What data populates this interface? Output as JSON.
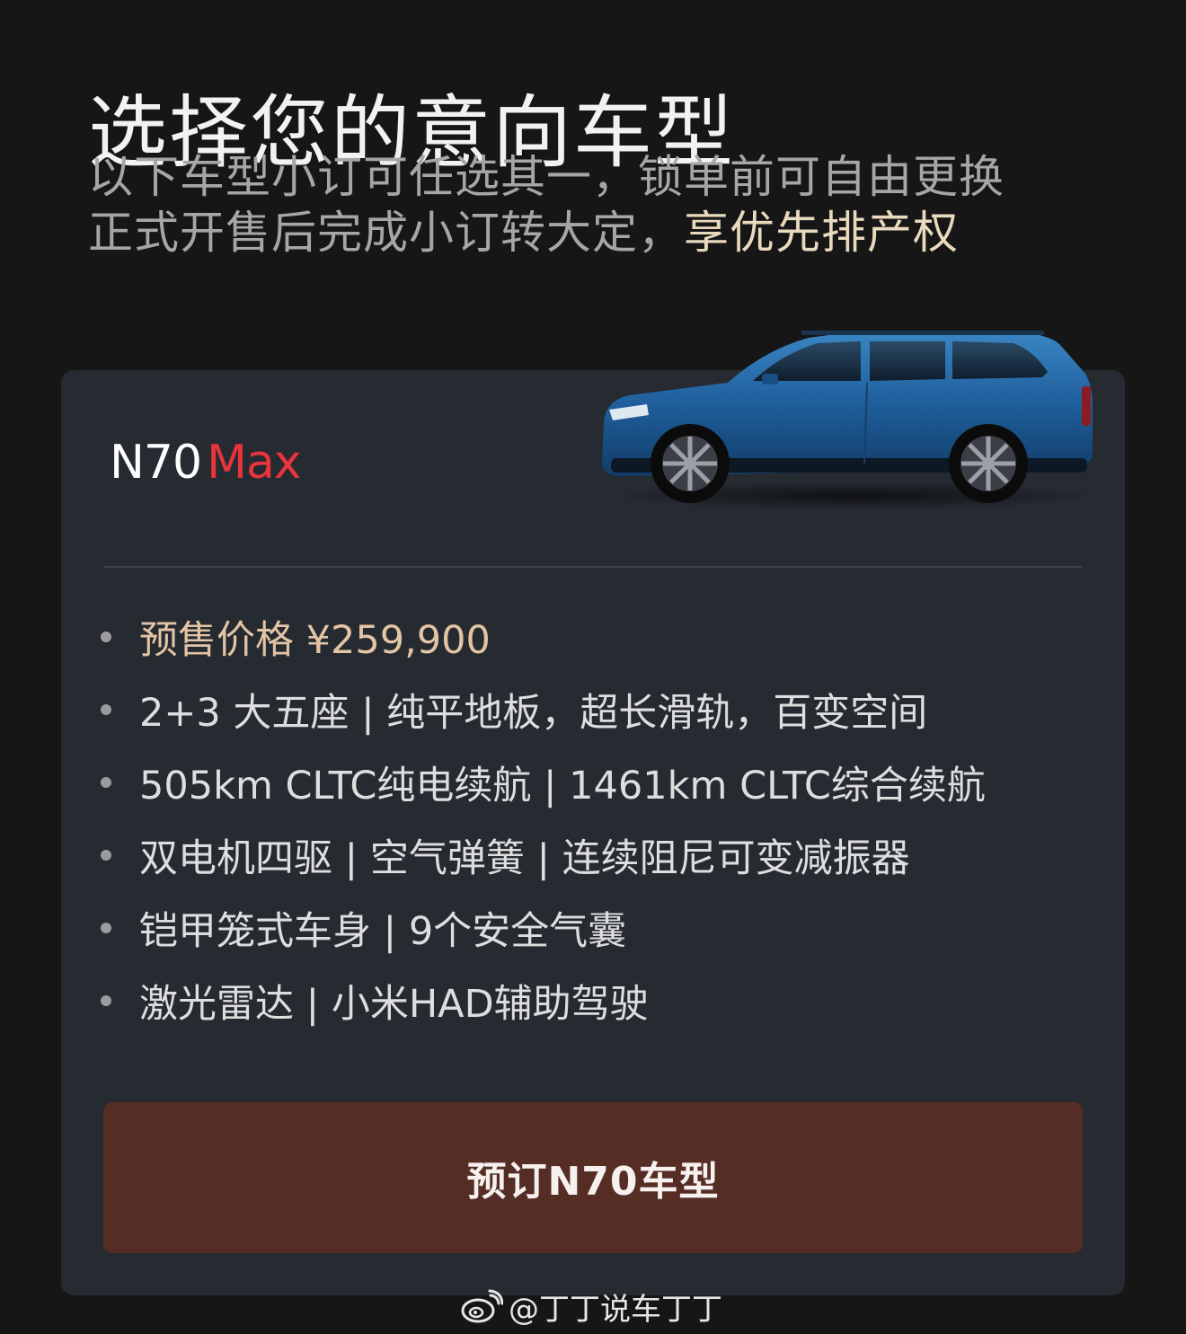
{
  "header": {
    "title": "选择您的意向车型",
    "subtitle_line1": "以下车型小订可任选其一，锁单前可自由更换",
    "subtitle_line2_prefix": "正式开售后完成小订转大定，",
    "subtitle_line2_highlight": "享优先排产权"
  },
  "card": {
    "model_base": "N70",
    "model_variant": "Max",
    "car_image_icon": "blue-suv-side-view",
    "features": [
      {
        "text": "预售价格  ¥259,900",
        "highlight": true
      },
      {
        "text": "2+3 大五座 | 纯平地板，超长滑轨，百变空间"
      },
      {
        "text": "505km CLTC纯电续航 | 1461km CLTC综合续航"
      },
      {
        "text": "双电机四驱 | 空气弹簧 | 连续阻尼可变减振器"
      },
      {
        "text": "铠甲笼式车身 | 9个安全气囊"
      },
      {
        "text": "激光雷达 | 小米HAD辅助驾驶"
      }
    ],
    "cta_label": "预订N70车型"
  },
  "watermark": {
    "icon": "weibo-icon",
    "text": "@丁丁说车丁丁"
  },
  "colors": {
    "background": "#161617",
    "card": "#262a31",
    "accent_red": "#e8343b",
    "price_gold": "#e3c4a4",
    "highlight_cream": "#e9d9bd",
    "cta_brown": "#552d25"
  }
}
